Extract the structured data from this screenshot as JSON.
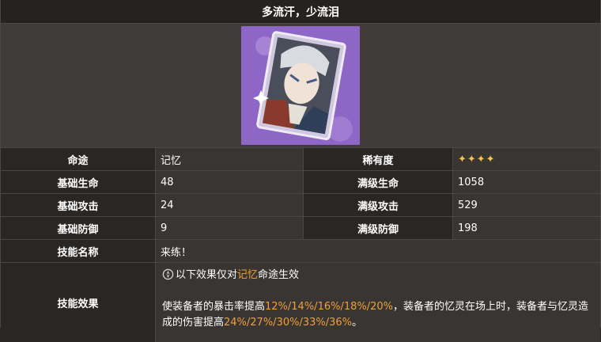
{
  "title": "多流汗，少流泪",
  "colors": {
    "highlight": "#f0a038",
    "star": "#f3c34e",
    "card_bg": "#8e66c6"
  },
  "icons": {
    "path": "remembrance-path-icon",
    "stars": "star-icon"
  },
  "rows": {
    "path": {
      "label": "命途",
      "value": "记忆",
      "label2": "稀有度",
      "stars": "✦✦✦✦"
    },
    "hp": {
      "label": "基础生命",
      "value": "48",
      "label2": "满级生命",
      "value2": "1058"
    },
    "atk": {
      "label": "基础攻击",
      "value": "24",
      "label2": "满级攻击",
      "value2": "529"
    },
    "def": {
      "label": "基础防御",
      "value": "9",
      "label2": "满级防御",
      "value2": "198"
    },
    "skill": {
      "label": "技能名称",
      "value": "来练！"
    },
    "effect": {
      "label": "技能效果",
      "cond_pre": "以下效果仅对",
      "cond_path": "记忆",
      "cond_post": "命途生效",
      "d1": "使装备者的暴击率提高",
      "v1": "12%/14%/16%/18%/20%",
      "d2": "，装备者的忆灵在场上时，装备者与忆灵造成的伤害提高",
      "v2": "24%/27%/30%/33%/36%",
      "d3": "。"
    }
  }
}
